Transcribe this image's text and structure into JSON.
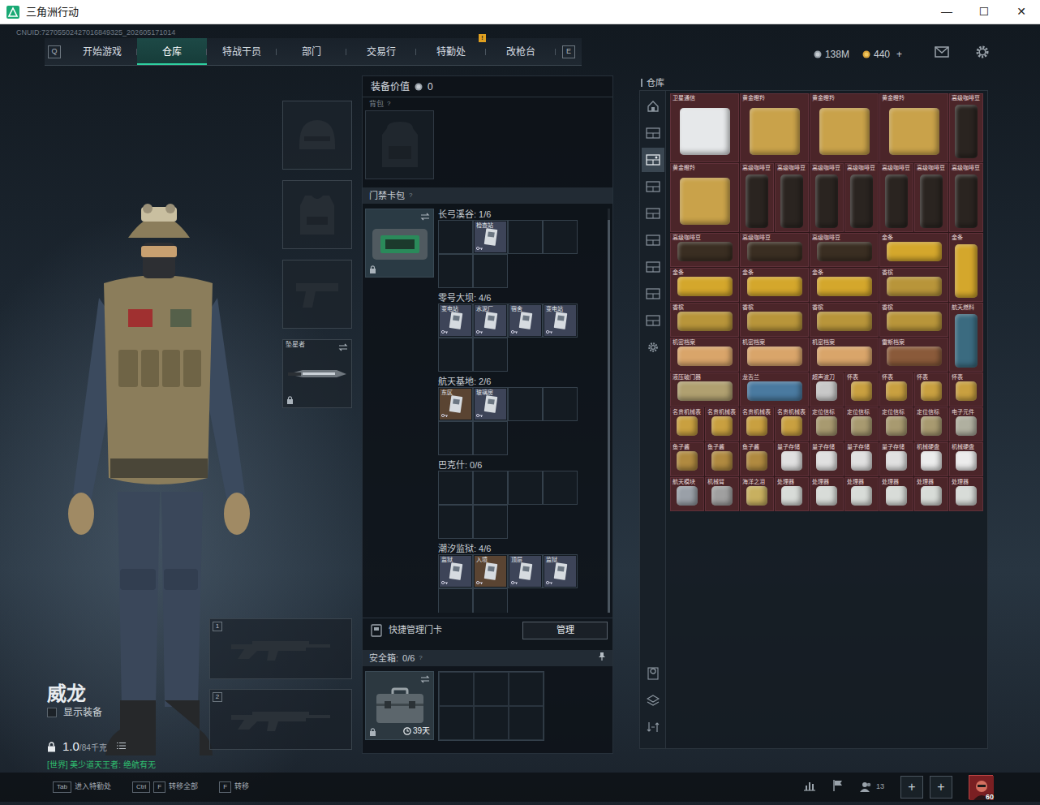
{
  "window": {
    "title": "三角洲行动",
    "controls": [
      "—",
      "☐",
      "✕"
    ]
  },
  "uid": "CNUID:72705502427016849325_202605171014",
  "nav": {
    "prev_key": "Q",
    "next_key": "E",
    "tabs": [
      {
        "label": "开始游戏",
        "selected": false,
        "badge": ""
      },
      {
        "label": "仓库",
        "selected": true,
        "badge": ""
      },
      {
        "label": "特战干员",
        "selected": false,
        "badge": ""
      },
      {
        "label": "部门",
        "selected": false,
        "badge": ""
      },
      {
        "label": "交易行",
        "selected": false,
        "badge": ""
      },
      {
        "label": "特勤处",
        "selected": false,
        "badge": "!"
      },
      {
        "label": "改枪台",
        "selected": false,
        "badge": ""
      }
    ]
  },
  "currency": {
    "money": "138M",
    "coins": "440",
    "add": "+"
  },
  "character": {
    "name": "威龙",
    "show_equipment_label": "显示装备",
    "show_equipment": false,
    "weight": "1.0",
    "weight_max": "/84千克",
    "chat": "[世界] 美少道天王者: 绝航有无"
  },
  "equipment": [
    {
      "kind": "helmet",
      "label": "",
      "swap": false,
      "locked": false
    },
    {
      "kind": "armor",
      "label": "",
      "swap": false,
      "locked": false
    },
    {
      "kind": "pistol",
      "label": "",
      "swap": false,
      "locked": false
    },
    {
      "kind": "melee",
      "label": "坠星者",
      "swap": true,
      "locked": true
    }
  ],
  "weapons": [
    {
      "number": "1"
    },
    {
      "number": "2"
    }
  ],
  "loadout": {
    "value_label": "装备价值",
    "value": "0",
    "backpack_label": "背包",
    "backpack_help": "?",
    "keycard_label": "门禁卡包",
    "keycard_help": "?",
    "holder_swap": true,
    "holder_locked": true,
    "maps": [
      {
        "title": "长弓溪谷: 1/6",
        "slots": [
          {
            "filled": false
          },
          {
            "filled": true,
            "label": "检查站",
            "color": "#3d4458"
          },
          {
            "filled": false
          },
          {
            "filled": false
          },
          {
            "filled": false
          },
          {
            "filled": false
          }
        ]
      },
      {
        "title": "零号大坝: 4/6",
        "slots": [
          {
            "filled": true,
            "label": "变电站",
            "color": "#3d4458"
          },
          {
            "filled": true,
            "label": "水泥厂",
            "color": "#3d4458"
          },
          {
            "filled": true,
            "label": "宿舍",
            "color": "#3d4458"
          },
          {
            "filled": true,
            "label": "变电站",
            "color": "#3d4458"
          },
          {
            "filled": false
          },
          {
            "filled": false
          }
        ]
      },
      {
        "title": "航天基地: 2/6",
        "slots": [
          {
            "filled": true,
            "label": "东区",
            "color": "#5a4432"
          },
          {
            "filled": true,
            "label": "玻璃房",
            "color": "#3d4458"
          },
          {
            "filled": false
          },
          {
            "filled": false
          },
          {
            "filled": false
          },
          {
            "filled": false
          }
        ]
      },
      {
        "title": "巴克什: 0/6",
        "slots": [
          {
            "filled": false
          },
          {
            "filled": false
          },
          {
            "filled": false
          },
          {
            "filled": false
          },
          {
            "filled": false
          },
          {
            "filled": false
          }
        ]
      },
      {
        "title": "潮汐监狱: 4/6",
        "slots": [
          {
            "filled": true,
            "label": "监狱",
            "color": "#3d4458"
          },
          {
            "filled": true,
            "label": "入境",
            "color": "#5a4432"
          },
          {
            "filled": true,
            "label": "顶层",
            "color": "#3d4458"
          },
          {
            "filled": true,
            "label": "监狱",
            "color": "#3d4458"
          },
          {
            "filled": false
          },
          {
            "filled": false
          }
        ]
      }
    ],
    "quick_manage": "快捷管理门卡",
    "manage_button": "管理",
    "safe_label": "安全箱:",
    "safe_count": "0/6",
    "safe_help": "?",
    "safe_days": "39天",
    "safe_swap": true,
    "safe_locked": true,
    "safe_slots": [
      {
        "filled": false
      },
      {
        "filled": false
      },
      {
        "filled": false
      },
      {
        "filled": false
      },
      {
        "filled": false
      },
      {
        "filled": false
      }
    ]
  },
  "warehouse": {
    "title": "仓库",
    "sidebar": [
      {
        "kind": "overview",
        "selected": false
      },
      {
        "kind": "stash",
        "selected": false
      },
      {
        "kind": "stash",
        "selected": true
      },
      {
        "kind": "stash",
        "selected": false
      },
      {
        "kind": "stash",
        "selected": false
      },
      {
        "kind": "stash",
        "selected": false
      },
      {
        "kind": "stash",
        "selected": false
      },
      {
        "kind": "stash",
        "selected": false
      },
      {
        "kind": "stash",
        "selected": false
      },
      {
        "kind": "settings",
        "selected": false
      }
    ],
    "tools": [
      {
        "kind": "sort"
      },
      {
        "kind": "layers"
      },
      {
        "kind": "transfer"
      }
    ],
    "items": [
      {
        "label": "卫星通信",
        "kind": "large",
        "color": "#e6e8ea"
      },
      {
        "label": "黄金瞪羚",
        "kind": "large",
        "color": "#c9a24a"
      },
      {
        "label": "黄金瞪羚",
        "kind": "large",
        "color": "#c9a24a"
      },
      {
        "label": "黄金瞪羚",
        "kind": "large",
        "color": "#c9a24a"
      },
      {
        "label": "高级咖啡豆",
        "kind": "tall",
        "color": "#2a2420"
      },
      {
        "label": "黄金瞪羚",
        "kind": "large",
        "color": "#c9a24a"
      },
      {
        "label": "高级咖啡豆",
        "kind": "tall",
        "color": "#2a2420"
      },
      {
        "label": "高级咖啡豆",
        "kind": "tall",
        "color": "#2a2420"
      },
      {
        "label": "高级咖啡豆",
        "kind": "tall",
        "color": "#2a2420"
      },
      {
        "label": "高级咖啡豆",
        "kind": "tall",
        "color": "#2a2420"
      },
      {
        "label": "高级咖啡豆",
        "kind": "tall",
        "color": "#2a2420"
      },
      {
        "label": "高级咖啡豆",
        "kind": "tall",
        "color": "#2a2420"
      },
      {
        "label": "高级咖啡豆",
        "kind": "tall",
        "color": "#2a2420"
      },
      {
        "label": "高级咖啡豆",
        "kind": "wide",
        "color": "#3a2e22"
      },
      {
        "label": "高级咖啡豆",
        "kind": "wide",
        "color": "#3a2e22"
      },
      {
        "label": "高级咖啡豆",
        "kind": "wide",
        "color": "#3a2e22"
      },
      {
        "label": "金条",
        "kind": "wide",
        "color": "#d4a72c"
      },
      {
        "label": "金条",
        "kind": "tall",
        "color": "#d4a72c"
      },
      {
        "label": "金条",
        "kind": "wide",
        "color": "#d4a72c"
      },
      {
        "label": "金条",
        "kind": "wide",
        "color": "#d4a72c"
      },
      {
        "label": "金条",
        "kind": "wide",
        "color": "#d4a72c"
      },
      {
        "label": "香槟",
        "kind": "wide",
        "color": "#b8953a"
      },
      {
        "label": "香槟",
        "kind": "wide",
        "color": "#b8953a"
      },
      {
        "label": "香槟",
        "kind": "wide",
        "color": "#b8953a"
      },
      {
        "label": "香槟",
        "kind": "wide",
        "color": "#b8953a"
      },
      {
        "label": "香槟",
        "kind": "wide",
        "color": "#b8953a"
      },
      {
        "label": "航天燃料",
        "kind": "tall",
        "color": "#3b6b80"
      },
      {
        "label": "机密档案",
        "kind": "wide",
        "color": "#d9a56a"
      },
      {
        "label": "机密档案",
        "kind": "wide",
        "color": "#d9a56a"
      },
      {
        "label": "机密档案",
        "kind": "wide",
        "color": "#d9a56a"
      },
      {
        "label": "雷斯档案",
        "kind": "wide",
        "color": "#8a5a3a"
      },
      {
        "label": "液压破门器",
        "kind": "wide",
        "color": "#b0a070"
      },
      {
        "label": "龙舌兰",
        "kind": "wide",
        "color": "#4a7aa0"
      },
      {
        "label": "超声波刀",
        "kind": "small",
        "color": "#c8c8c8"
      },
      {
        "label": "怀表",
        "kind": "small",
        "color": "#c9a040"
      },
      {
        "label": "怀表",
        "kind": "small",
        "color": "#c9a040"
      },
      {
        "label": "怀表",
        "kind": "small",
        "color": "#c9a040"
      },
      {
        "label": "怀表",
        "kind": "small",
        "color": "#c9a040"
      },
      {
        "label": "名贵机械表",
        "kind": "small",
        "color": "#c9a040"
      },
      {
        "label": "名贵机械表",
        "kind": "small",
        "color": "#c9a040"
      },
      {
        "label": "名贵机械表",
        "kind": "small",
        "color": "#c9a040"
      },
      {
        "label": "名贵机械表",
        "kind": "small",
        "color": "#c9a040"
      },
      {
        "label": "定位信标",
        "kind": "small",
        "color": "#a89a70"
      },
      {
        "label": "定位信标",
        "kind": "small",
        "color": "#a89a70"
      },
      {
        "label": "定位信标",
        "kind": "small",
        "color": "#a89a70"
      },
      {
        "label": "定位信标",
        "kind": "small",
        "color": "#a89a70"
      },
      {
        "label": "电子元件",
        "kind": "small",
        "color": "#b0b0a0"
      },
      {
        "label": "鱼子酱",
        "kind": "small",
        "color": "#b08a40"
      },
      {
        "label": "鱼子酱",
        "kind": "small",
        "color": "#b08a40"
      },
      {
        "label": "鱼子酱",
        "kind": "small",
        "color": "#b08a40"
      },
      {
        "label": "量子存储",
        "kind": "small",
        "color": "#e0e0e0"
      },
      {
        "label": "量子存储",
        "kind": "small",
        "color": "#e0e0e0"
      },
      {
        "label": "量子存储",
        "kind": "small",
        "color": "#e0e0e0"
      },
      {
        "label": "量子存储",
        "kind": "small",
        "color": "#e0e0e0"
      },
      {
        "label": "机械硬盘",
        "kind": "small",
        "color": "#ececec"
      },
      {
        "label": "机械硬盘",
        "kind": "small",
        "color": "#ececec"
      },
      {
        "label": "航天模块",
        "kind": "small",
        "color": "#9aa0a8"
      },
      {
        "label": "机械臂",
        "kind": "small",
        "color": "#a0a0a0"
      },
      {
        "label": "海洋之泪",
        "kind": "small",
        "color": "#c8b060"
      },
      {
        "label": "处理器",
        "kind": "small",
        "color": "#d8dcd8"
      },
      {
        "label": "处理器",
        "kind": "small",
        "color": "#d8dcd8"
      },
      {
        "label": "处理器",
        "kind": "small",
        "color": "#d8dcd8"
      },
      {
        "label": "处理器",
        "kind": "small",
        "color": "#d8dcd8"
      },
      {
        "label": "处理器",
        "kind": "small",
        "color": "#d8dcd8"
      },
      {
        "label": "处理器",
        "kind": "small",
        "color": "#d8dcd8"
      }
    ]
  },
  "bottom": {
    "hints": [
      {
        "keys": [
          "Tab"
        ],
        "label": "进入特勤处"
      },
      {
        "keys": [
          "Ctrl",
          "F"
        ],
        "label": "转移全部"
      },
      {
        "keys": [
          "F"
        ],
        "label": "转移"
      }
    ],
    "friends": "13",
    "slots": [
      "+",
      "+"
    ],
    "level": "60"
  }
}
